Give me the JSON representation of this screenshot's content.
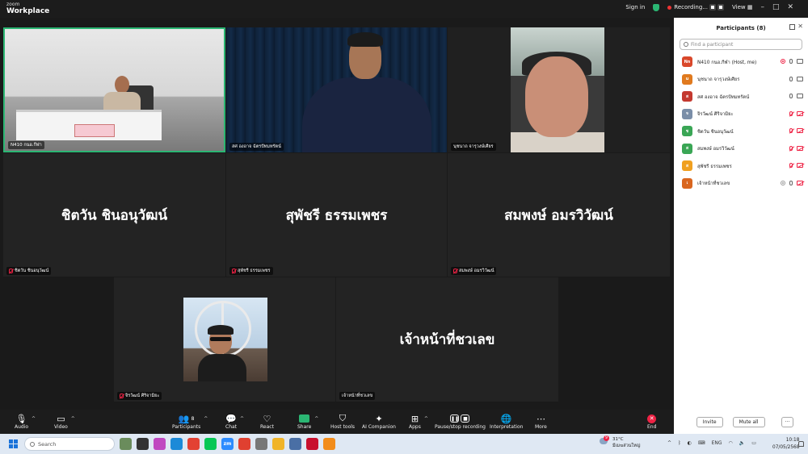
{
  "app": {
    "logo_top": "zoom",
    "logo_bottom": "Workplace",
    "sign_in": "Sign in",
    "recording_label": "Recording...",
    "view_label": "View",
    "accent_color": "#2bb673"
  },
  "tiles": [
    {
      "name": "N410 กนอ.กีฬา",
      "big_name": "",
      "video": true,
      "muted": false
    },
    {
      "name": "สศ องอาจ ฉัตรปัทมทรัตน์",
      "big_name": "",
      "video": true,
      "muted": false
    },
    {
      "name": "นุชนาถ จารุวงษ์เศียร",
      "big_name": "",
      "video": true,
      "muted": false
    },
    {
      "name": "ชิตวัน ชินอนุวัฒน์",
      "big_name": "ชิตวัน ชินอนุวัฒน์",
      "video": false,
      "muted": true
    },
    {
      "name": "สุพัชรี ธรรมเพชร",
      "big_name": "สุพัชรี ธรรมเพชร",
      "video": false,
      "muted": true
    },
    {
      "name": "สมพงษ์ อมรวิวัฒน์",
      "big_name": "สมพงษ์ อมรวิวัฒน์",
      "video": false,
      "muted": true
    },
    {
      "name": "จิรวัฒน์ ศิริจามิยะ",
      "big_name": "",
      "video": false,
      "muted": true
    },
    {
      "name": "เจ้าหน้าที่ชวเลข",
      "big_name": "เจ้าหน้าที่ชวเลข",
      "video": false,
      "muted": false
    }
  ],
  "participants_panel": {
    "title": "Participants (8)",
    "search_placeholder": "Find a participant",
    "invite_label": "Invite",
    "mute_all_label": "Mute all",
    "more_label": "···",
    "items": [
      {
        "initials": "Nn",
        "color": "#d9482b",
        "name": "N410 กนอ.กีฬา (Host, me)",
        "mic_off": false,
        "cam_off": false,
        "rec": true
      },
      {
        "initials": "u",
        "color": "#e07a1f",
        "name": "นุชนาถ จารุวงษ์เศียร",
        "mic_off": false,
        "cam_off": false,
        "rec": false
      },
      {
        "initials": "ส",
        "color": "#c4392f",
        "name": "สศ องอาจ ฉัตรปัทมทรัตน์",
        "mic_off": false,
        "cam_off": false,
        "rec": false
      },
      {
        "initials": "จ",
        "color": "#7a8ea8",
        "name": "จิรวัฒน์ ศิริจามิยะ",
        "mic_off": true,
        "cam_off": true,
        "rec": false
      },
      {
        "initials": "ช",
        "color": "#3aa655",
        "name": "ชิตวัน ชินอนุวัฒน์",
        "mic_off": true,
        "cam_off": true,
        "rec": false
      },
      {
        "initials": "ส",
        "color": "#3aa655",
        "name": "สมพงษ์ อมรวิวัฒน์",
        "mic_off": true,
        "cam_off": true,
        "rec": false
      },
      {
        "initials": "ส",
        "color": "#f0a020",
        "name": "สุพัชรี ธรรมเพชร",
        "mic_off": true,
        "cam_off": true,
        "rec": false
      },
      {
        "initials": "เ",
        "color": "#d9661f",
        "name": "เจ้าหน้าที่ชวเลข",
        "mic_off": false,
        "cam_off": true,
        "rec": true
      }
    ]
  },
  "toolbar": {
    "audio": "Audio",
    "video": "Video",
    "participants": "Participants",
    "participants_count": "8",
    "chat": "Chat",
    "react": "React",
    "share": "Share",
    "host_tools": "Host tools",
    "ai_companion": "AI Companion",
    "apps": "Apps",
    "pause_stop": "Pause/stop recording",
    "interpretation": "Interpretation",
    "more": "More",
    "end": "End"
  },
  "taskbar": {
    "search_placeholder": "Search",
    "weather_temp": "31°C",
    "weather_desc": "มีเมฆส่วนใหญ่",
    "weather_badge": "9",
    "lang": "ENG",
    "time": "10:18",
    "date": "07/05/2568"
  }
}
